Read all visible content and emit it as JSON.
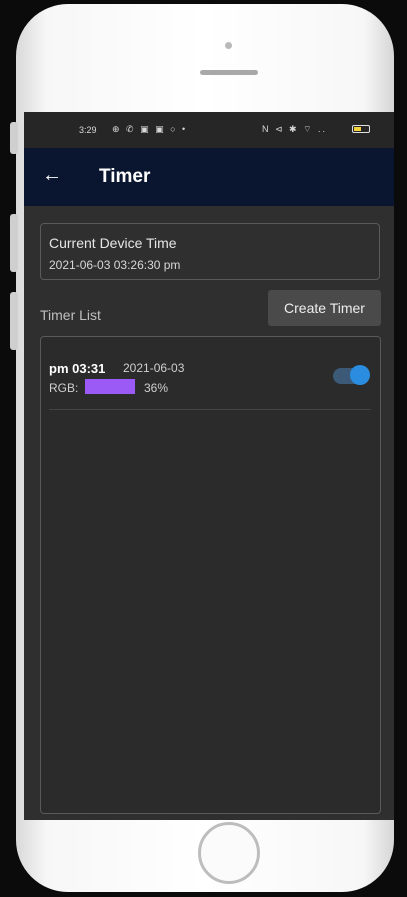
{
  "status_bar": {
    "time": "3:29",
    "left_icons": "⊕ ✆ ▣ ▣ ○ •",
    "right_icons": "N ⊲ ✱ ⌔ ..",
    "battery_color": "#f3d23b"
  },
  "appbar": {
    "back_icon": "←",
    "title": "Timer"
  },
  "device": {
    "label": "Current Device Time",
    "time": "2021-06-03 03:26:30 pm"
  },
  "timer_list": {
    "label": "Timer List",
    "create_button": "Create Timer",
    "items": [
      {
        "time": "pm 03:31",
        "date": "2021-06-03",
        "rgb_label": "RGB:",
        "color": "#9b59f6",
        "percent": "36%",
        "enabled": true
      }
    ]
  },
  "colors": {
    "appbar": "#0a1630",
    "toggle_on": "#2b8de0",
    "screen_bg": "#2f2f2f"
  }
}
